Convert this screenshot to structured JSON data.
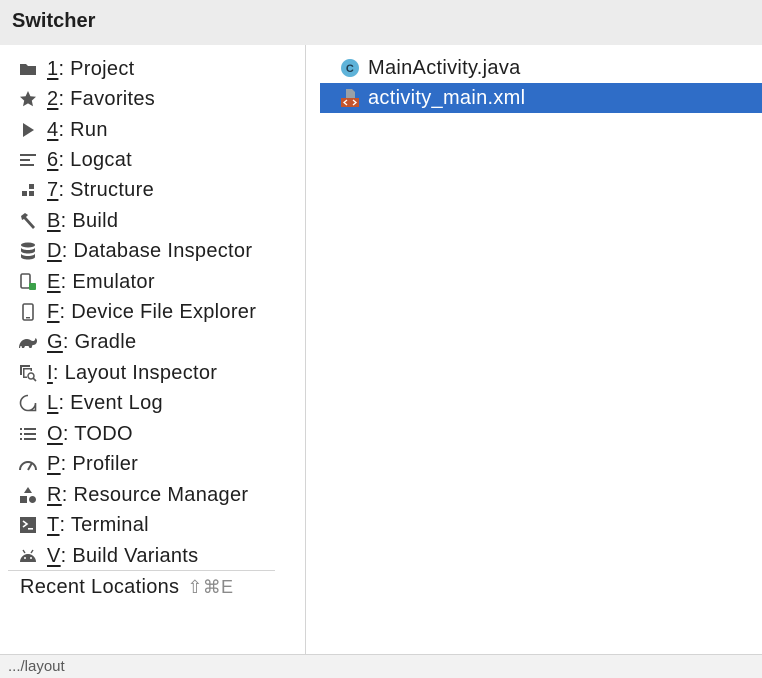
{
  "window": {
    "title": "Switcher"
  },
  "tool_windows": [
    {
      "mnemonic": "1",
      "label": ": Project",
      "icon": "folder-icon"
    },
    {
      "mnemonic": "2",
      "label": ": Favorites",
      "icon": "star-icon"
    },
    {
      "mnemonic": "4",
      "label": ": Run",
      "icon": "play-icon"
    },
    {
      "mnemonic": "6",
      "label": ": Logcat",
      "icon": "logcat-icon"
    },
    {
      "mnemonic": "7",
      "label": ": Structure",
      "icon": "structure-icon"
    },
    {
      "mnemonic": "B",
      "label": ": Build",
      "icon": "hammer-icon"
    },
    {
      "mnemonic": "D",
      "label": ": Database Inspector",
      "icon": "database-icon"
    },
    {
      "mnemonic": "E",
      "label": ": Emulator",
      "icon": "emulator-icon"
    },
    {
      "mnemonic": "F",
      "label": ": Device File Explorer",
      "icon": "device-icon"
    },
    {
      "mnemonic": "G",
      "label": ": Gradle",
      "icon": "gradle-icon"
    },
    {
      "mnemonic": "I",
      "label": ": Layout Inspector",
      "icon": "layout-inspector-icon"
    },
    {
      "mnemonic": "L",
      "label": ": Event Log",
      "icon": "event-log-icon"
    },
    {
      "mnemonic": "O",
      "label": ": TODO",
      "icon": "todo-list-icon"
    },
    {
      "mnemonic": "P",
      "label": ": Profiler",
      "icon": "gauge-icon"
    },
    {
      "mnemonic": "R",
      "label": ": Resource Manager",
      "icon": "resources-icon"
    },
    {
      "mnemonic": "T",
      "label": ": Terminal",
      "icon": "terminal-icon"
    },
    {
      "mnemonic": "V",
      "label": ": Build Variants",
      "icon": "android-icon"
    }
  ],
  "recent_locations": {
    "label": "Recent Locations",
    "shortcut": "⇧⌘E"
  },
  "files": [
    {
      "name": "MainActivity.java",
      "icon": "java-class-icon",
      "selected": false
    },
    {
      "name": "activity_main.xml",
      "icon": "xml-layout-icon",
      "selected": true
    }
  ],
  "status": {
    "path": ".../layout"
  },
  "colors": {
    "selection": "#2f6dc7",
    "title_bar": "#ececec",
    "java_icon": "#5fb3d9",
    "xml_icon": "#c4552e"
  }
}
